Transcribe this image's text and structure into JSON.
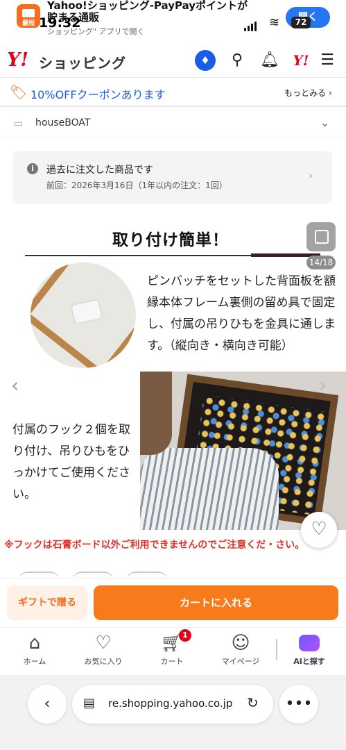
{
  "status": {
    "time": "19:32",
    "battery": "72",
    "app_banner": {
      "icon_label": "最短",
      "title_line1": "Yahoo!ショッピング-PayPayポイントが",
      "title_line2": "貯まる通販",
      "subtitle": "ショッピング\" アプリで開く",
      "open_label": "開く"
    }
  },
  "header": {
    "logo_mark": "Y!",
    "logo_text": "ショッピング",
    "icons": [
      "coupon-icon",
      "search-icon",
      "bell-icon",
      "yahoo-icon",
      "menu-icon"
    ],
    "yahoo_mark": "Y!"
  },
  "coupon_bar": {
    "text": "10%OFFクーポンあります",
    "more": "もっとみる ›"
  },
  "store": {
    "name": "houseBOAT"
  },
  "past_order": {
    "title": "過去に注文した商品です",
    "detail": "前回：2026年3月16日（1年以内の注文：1回）"
  },
  "product_image": {
    "title": "取り付け簡単！",
    "counter": "14/18",
    "paragraph1": "ピンバッチをセットした背面板を額縁本体フレーム裏側の留め具で固定し、付属の吊りひもを金具に通します。（縦向き・横向き可能）",
    "paragraph2": "付属のフック２個を取り付け、吊りひもをひっかけてご使用ください。",
    "notice": "※フックは石膏ボード以外ご利用できませんのでご注意くだ・さい。"
  },
  "cart_bar": {
    "gift_label": "ギフトで贈る",
    "cart_label": "カートに入れる"
  },
  "tabbar": {
    "items": [
      {
        "label": "ホーム",
        "icon": "home-icon"
      },
      {
        "label": "お気に入り",
        "icon": "heart-icon"
      },
      {
        "label": "カート",
        "icon": "cart-icon"
      },
      {
        "label": "マイページ",
        "icon": "person-icon"
      },
      {
        "label": "AIと探す",
        "icon": "ai-icon"
      }
    ],
    "cart_badge": "1"
  },
  "browser": {
    "url": "re.shopping.yahoo.co.jp"
  },
  "colors": {
    "accent_orange": "#f97a1a",
    "yahoo_red": "#e0031e",
    "link_blue": "#1a5ce6"
  }
}
